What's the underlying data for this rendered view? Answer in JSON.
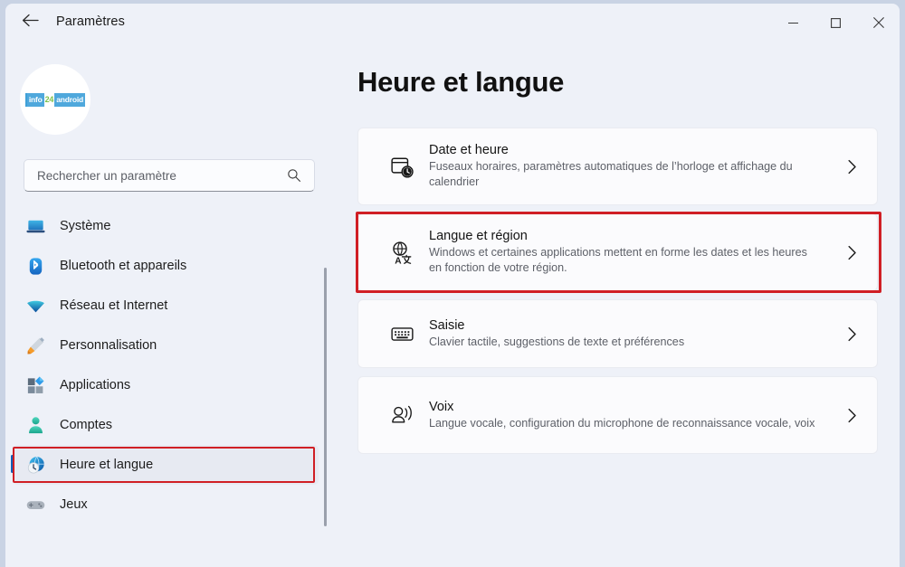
{
  "window": {
    "title": "Paramètres",
    "back_icon": "back-arrow-icon",
    "controls": {
      "minimize": "minimize-icon",
      "maximize": "maximize-icon",
      "close": "close-icon"
    }
  },
  "sidebar": {
    "avatar": {
      "logo_text": "info24android",
      "logo_left": "info",
      "logo_mid": "24",
      "logo_right": "android"
    },
    "search": {
      "placeholder": "Rechercher un paramètre",
      "value": "",
      "icon": "search-icon"
    },
    "items": [
      {
        "label": "Système",
        "icon": "laptop-icon",
        "selected": false
      },
      {
        "label": "Bluetooth et appareils",
        "icon": "bluetooth-icon",
        "selected": false
      },
      {
        "label": "Réseau et Internet",
        "icon": "wifi-icon",
        "selected": false
      },
      {
        "label": "Personnalisation",
        "icon": "paintbrush-icon",
        "selected": false
      },
      {
        "label": "Applications",
        "icon": "apps-icon",
        "selected": false
      },
      {
        "label": "Comptes",
        "icon": "person-icon",
        "selected": false
      },
      {
        "label": "Heure et langue",
        "icon": "clock-globe-icon",
        "selected": true
      },
      {
        "label": "Jeux",
        "icon": "gamepad-icon",
        "selected": false
      }
    ]
  },
  "main": {
    "page_title": "Heure et langue",
    "cards": [
      {
        "title": "Date et heure",
        "desc": "Fuseaux horaires, paramètres automatiques de l’horloge et affichage du calendrier",
        "icon": "calendar-clock-icon",
        "chevron": "chevron-right-icon",
        "highlighted": false
      },
      {
        "title": "Langue et région",
        "desc": "Windows et certaines applications mettent en forme les dates et les heures en fonction de votre région.",
        "icon": "globe-language-icon",
        "chevron": "chevron-right-icon",
        "highlighted": true
      },
      {
        "title": "Saisie",
        "desc": "Clavier tactile, suggestions de texte et préférences",
        "icon": "keyboard-icon",
        "chevron": "chevron-right-icon",
        "highlighted": false
      },
      {
        "title": "Voix",
        "desc": "Langue vocale, configuration du microphone de reconnaissance vocale, voix",
        "icon": "speech-icon",
        "chevron": "chevron-right-icon",
        "highlighted": false
      }
    ]
  },
  "colors": {
    "highlight_red": "#d01f25",
    "accent_blue": "#0f5fb8",
    "window_bg": "#eef1f8",
    "card_bg": "#fbfbfd"
  }
}
